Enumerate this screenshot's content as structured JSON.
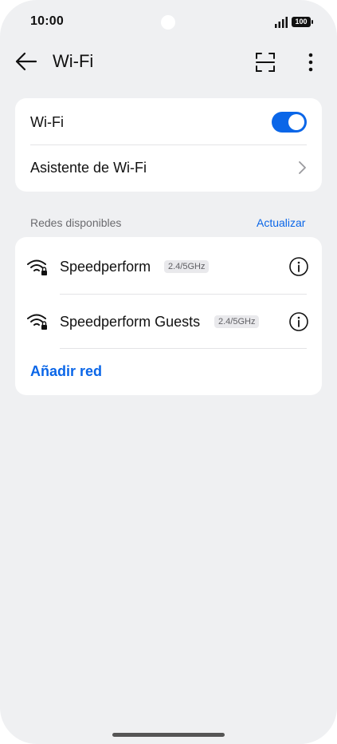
{
  "status_bar": {
    "time": "10:00",
    "battery": "100"
  },
  "header": {
    "title": "Wi-Fi"
  },
  "main_card": {
    "wifi_label": "Wi-Fi",
    "wifi_enabled": true,
    "assistant_label": "Asistente de Wi-Fi"
  },
  "networks_section": {
    "label": "Redes disponibles",
    "refresh_label": "Actualizar",
    "items": [
      {
        "name": "Speedperform",
        "band": "2.4/5GHz",
        "icon": "wifi-lock-icon"
      },
      {
        "name": "Speedperform Guests",
        "band": "2.4/5GHz",
        "icon": "wifi-lock-icon"
      }
    ],
    "add_label": "Añadir red"
  },
  "colors": {
    "accent": "#0a66e8",
    "background": "#eff0f2",
    "card": "#ffffff"
  }
}
